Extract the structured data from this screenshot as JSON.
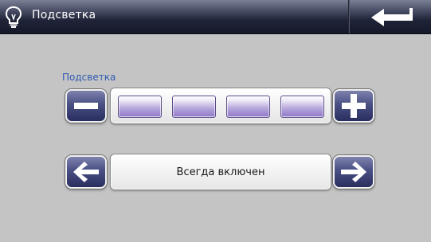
{
  "header": {
    "icon": "lightbulb-icon",
    "title": "Подсветка",
    "back_icon": "return-arrow-icon"
  },
  "backlight": {
    "label": "Подсветка",
    "decrease_icon": "minus-icon",
    "increase_icon": "plus-icon",
    "level": 4,
    "max_level": 4
  },
  "mode": {
    "prev_icon": "arrow-left-icon",
    "next_icon": "arrow-right-icon",
    "value": "Всегда включен"
  },
  "colors": {
    "title_bar": "#1f2438",
    "button": "#4a4f84",
    "segment": "#b7a6dc",
    "label": "#2f5bb0",
    "background": "#c6c6c6"
  }
}
